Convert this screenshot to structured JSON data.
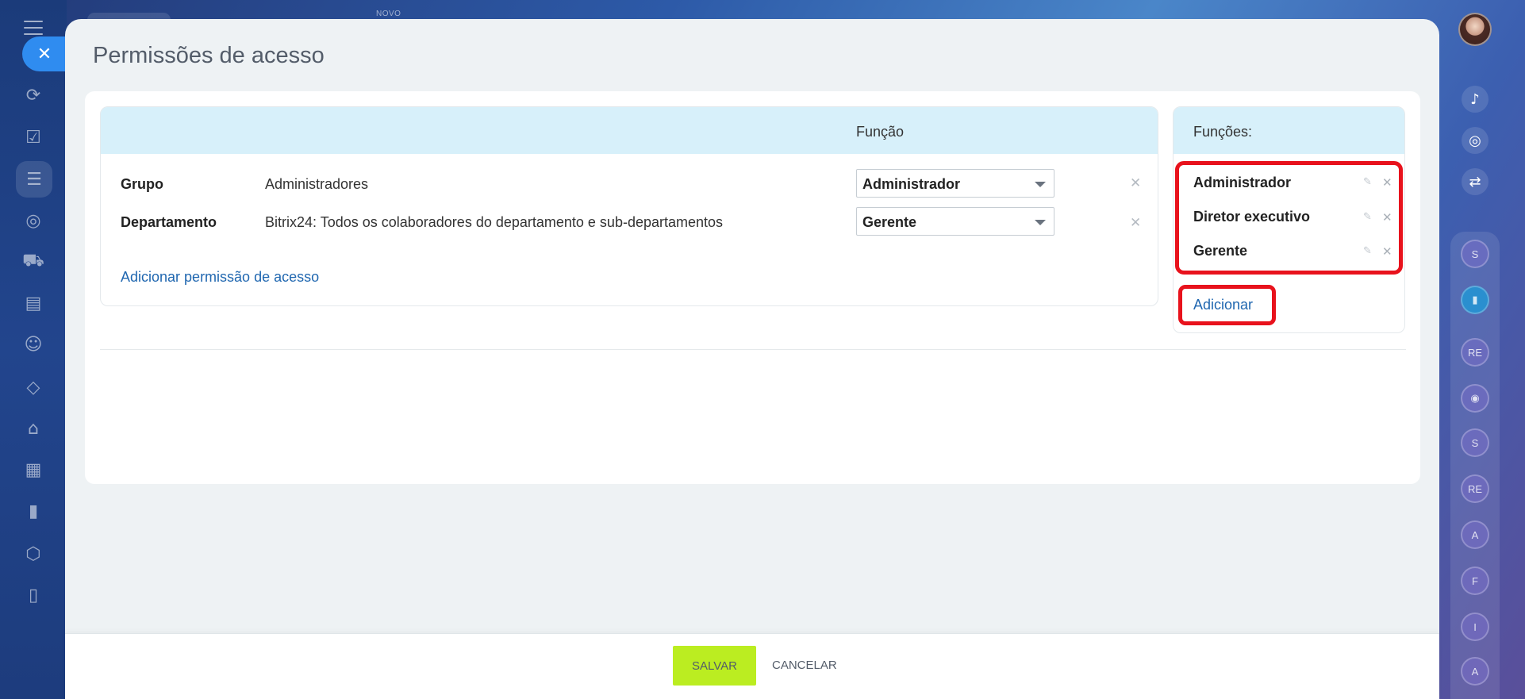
{
  "topbar": {
    "novo_label": "NOVO"
  },
  "panel": {
    "title": "Permissões de acesso",
    "table": {
      "header_func": "Função",
      "rows": [
        {
          "type": "Grupo",
          "name": "Administradores",
          "role": "Administrador"
        },
        {
          "type": "Departamento",
          "name": "Bitrix24: Todos os colaboradores do departamento e sub-departamentos",
          "role": "Gerente"
        }
      ],
      "add_link": "Adicionar permissão de acesso"
    },
    "roles": {
      "header": "Funções:",
      "items": [
        "Administrador",
        "Diretor executivo",
        "Gerente"
      ],
      "add_link": "Adicionar"
    }
  },
  "footer": {
    "save_label": "SALVAR",
    "cancel_label": "CANCELAR"
  },
  "right_bar": {
    "bubbles": [
      "S",
      "RE",
      "S",
      "RE",
      "A",
      "F",
      "I",
      "A"
    ]
  },
  "colors": {
    "save": "#bbed21",
    "link": "#2067b0",
    "highlight": "#e8121c",
    "table_header": "#d7f0fa"
  }
}
